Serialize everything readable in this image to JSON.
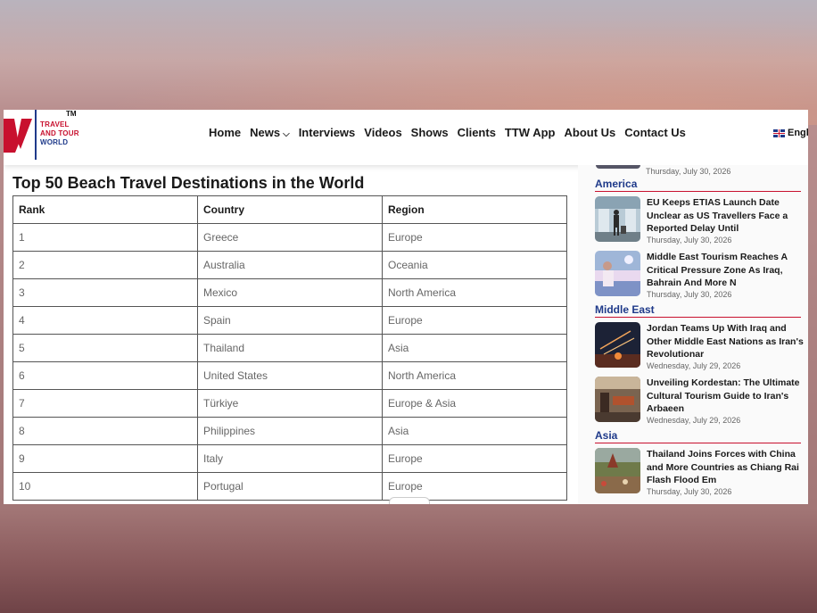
{
  "header": {
    "logo": {
      "tm": "TM",
      "line1": "TRAVEL",
      "line2": "AND TOUR",
      "line3": "WORLD"
    },
    "nav": [
      {
        "label": "Home"
      },
      {
        "label": "News",
        "has_dropdown": true
      },
      {
        "label": "Interviews"
      },
      {
        "label": "Videos"
      },
      {
        "label": "Shows"
      },
      {
        "label": "Clients"
      },
      {
        "label": "TTW App"
      },
      {
        "label": "About Us"
      },
      {
        "label": "Contact Us"
      }
    ],
    "language": "Engl"
  },
  "article": {
    "title": "Top 50 Beach Travel Destinations in the World",
    "table": {
      "headers": [
        "Rank",
        "Country",
        "Region"
      ],
      "rows": [
        [
          "1",
          "Greece",
          "Europe"
        ],
        [
          "2",
          "Australia",
          "Oceania"
        ],
        [
          "3",
          "Mexico",
          "North America"
        ],
        [
          "4",
          "Spain",
          "Europe"
        ],
        [
          "5",
          "Thailand",
          "Asia"
        ],
        [
          "6",
          "United States",
          "North America"
        ],
        [
          "7",
          "Türkiye",
          "Europe & Asia"
        ],
        [
          "8",
          "Philippines",
          "Asia"
        ],
        [
          "9",
          "Italy",
          "Europe"
        ],
        [
          "10",
          "Portugal",
          "Europe"
        ]
      ]
    }
  },
  "sidebar": {
    "top_date": "Thursday, July 30, 2026",
    "sections": [
      {
        "name": "America",
        "items": [
          {
            "headline": "EU Keeps ETIAS Launch Date Unclear as US Travellers Face a Reported Delay Until",
            "date": "Thursday, July 30, 2026",
            "thumb_icon": "airport-traveller-thumbnail"
          },
          {
            "headline": "Middle East Tourism Reaches A Critical Pressure Zone As Iraq, Bahrain And More N",
            "date": "Thursday, July 30, 2026",
            "thumb_icon": "woman-coastline-thumbnail"
          }
        ]
      },
      {
        "name": "Middle East",
        "items": [
          {
            "headline": "Jordan Teams Up With Iraq and Other Middle East Nations as Iran's Revolutionar",
            "date": "Wednesday, July 29, 2026",
            "thumb_icon": "night-sky-missiles-thumbnail"
          },
          {
            "headline": "Unveiling Kordestan: The Ultimate Cultural Tourism Guide to Iran's Arbaeen",
            "date": "Wednesday, July 29, 2026",
            "thumb_icon": "market-stall-thumbnail"
          }
        ]
      },
      {
        "name": "Asia",
        "items": [
          {
            "headline": "Thailand Joins Forces with China and More Countries as Chiang Rai Flash Flood Em",
            "date": "Thursday, July 30, 2026",
            "thumb_icon": "temple-flood-thumbnail"
          }
        ]
      }
    ]
  },
  "colors": {
    "brand_red": "#c8102e",
    "brand_blue": "#1f3a8a"
  }
}
